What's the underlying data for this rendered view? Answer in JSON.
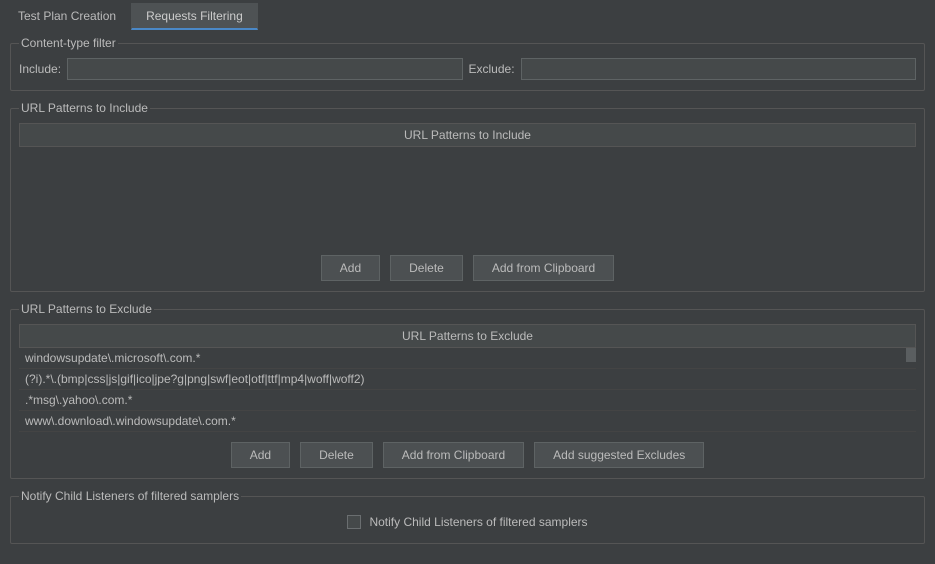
{
  "tabs": {
    "testPlan": "Test Plan Creation",
    "requestsFiltering": "Requests Filtering"
  },
  "contentTypeFilter": {
    "legend": "Content-type filter",
    "includeLabel": "Include:",
    "includeValue": "",
    "excludeLabel": "Exclude:",
    "excludeValue": ""
  },
  "includePatterns": {
    "legend": "URL Patterns to Include",
    "header": "URL Patterns to Include",
    "rows": [],
    "buttons": {
      "add": "Add",
      "delete": "Delete",
      "clipboard": "Add from Clipboard"
    }
  },
  "excludePatterns": {
    "legend": "URL Patterns to Exclude",
    "header": "URL Patterns to Exclude",
    "rows": [
      "windowsupdate\\.microsoft\\.com.*",
      "(?i).*\\.(bmp|css|js|gif|ico|jpe?g|png|swf|eot|otf|ttf|mp4|woff|woff2)",
      ".*msg\\.yahoo\\.com.*",
      "www\\.download\\.windowsupdate\\.com.*"
    ],
    "buttons": {
      "add": "Add",
      "delete": "Delete",
      "clipboard": "Add from Clipboard",
      "suggested": "Add suggested Excludes"
    }
  },
  "notify": {
    "legend": "Notify Child Listeners of filtered samplers",
    "checkboxLabel": "Notify Child Listeners of filtered samplers",
    "checked": false
  }
}
